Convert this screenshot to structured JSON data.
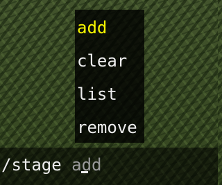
{
  "chat": {
    "typed": "/stage ",
    "suggestion_ghost": "add"
  },
  "suggestions": {
    "selected_index": 0,
    "items": [
      "add",
      "clear",
      "list",
      "remove"
    ]
  },
  "colors": {
    "selected_suggestion": "#f6f600",
    "suggestion_text": "#ededed",
    "ghost_text": "#9a9a9a"
  }
}
